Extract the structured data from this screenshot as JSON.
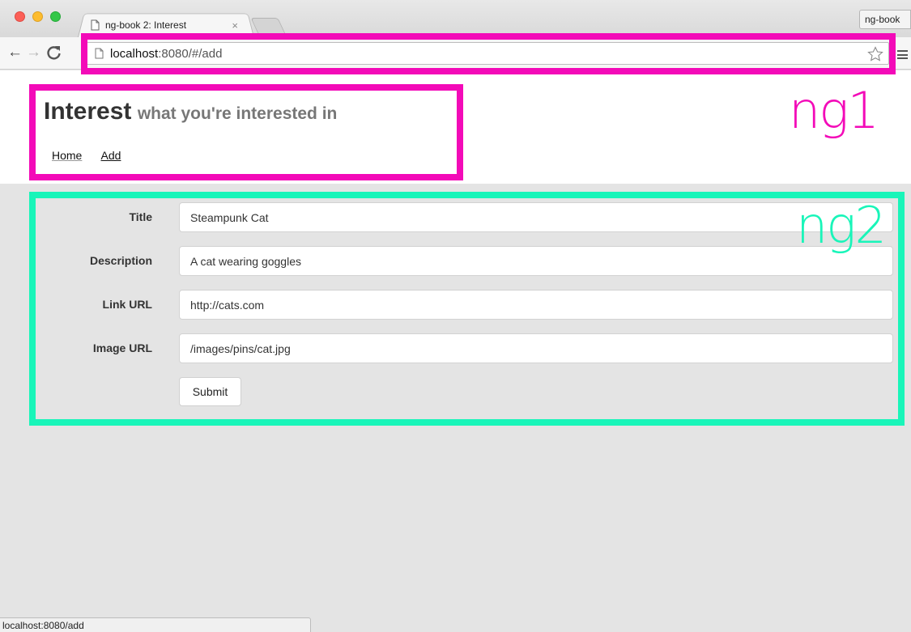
{
  "browser": {
    "tab_title": "ng-book 2: Interest",
    "tab_close": "×",
    "profile_label": "ng-book",
    "address_host": "localhost",
    "address_rest": ":8080/#/add",
    "status_url": "localhost:8080/add"
  },
  "header": {
    "title": "Interest",
    "subtitle": "what you're interested in",
    "nav": [
      {
        "label": "Home"
      },
      {
        "label": "Add"
      }
    ]
  },
  "form": {
    "fields": [
      {
        "label": "Title",
        "value": "Steampunk Cat"
      },
      {
        "label": "Description",
        "value": "A cat wearing goggles"
      },
      {
        "label": "Link URL",
        "value": "http://cats.com"
      },
      {
        "label": "Image URL",
        "value": "/images/pins/cat.jpg"
      }
    ],
    "submit_label": "Submit"
  },
  "annotations": {
    "ng1": "ng1",
    "ng2": "ng2",
    "ng1_color": "#f30ab8",
    "ng2_color": "#19f5b9"
  },
  "icons": [
    "page-icon",
    "back-arrow-icon",
    "forward-arrow-icon",
    "reload-icon",
    "star-icon",
    "menu-icon"
  ]
}
